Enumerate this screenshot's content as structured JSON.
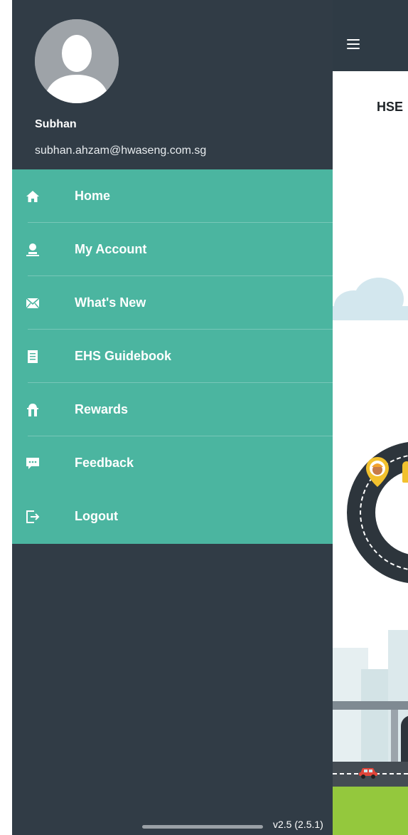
{
  "app": {
    "title": "HSE"
  },
  "drawer": {
    "user": {
      "name": "Subhan",
      "email": "subhan.ahzam@hwaseng.com.sg"
    },
    "items": [
      {
        "label": "Home",
        "icon": "home-icon"
      },
      {
        "label": "My Account",
        "icon": "user-icon"
      },
      {
        "label": "What's New",
        "icon": "mail-icon"
      },
      {
        "label": "EHS Guidebook",
        "icon": "book-icon"
      },
      {
        "label": "Rewards",
        "icon": "gift-icon"
      },
      {
        "label": "Feedback",
        "icon": "chat-icon"
      },
      {
        "label": "Logout",
        "icon": "logout-icon"
      }
    ],
    "version": "v2.5 (2.5.1)"
  },
  "colors": {
    "drawer_bg": "#313c46",
    "menu_bg": "#4bb5a0",
    "header_bg": "#2f3b45",
    "grass": "#94c83d"
  }
}
